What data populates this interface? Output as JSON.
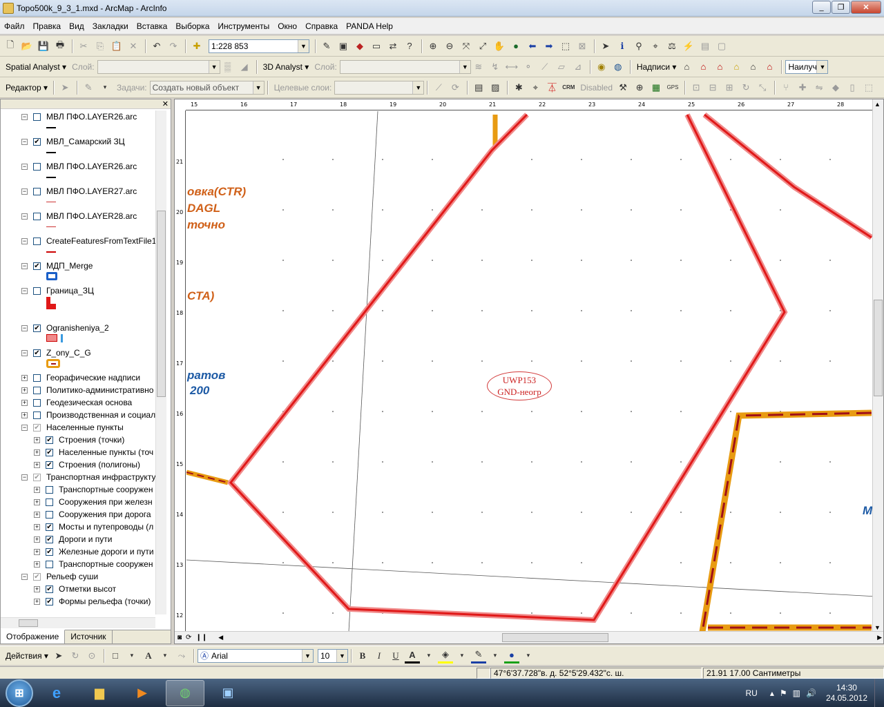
{
  "window": {
    "title": "Topo500k_9_3_1.mxd - ArcMap - ArcInfo"
  },
  "menu": [
    "Файл",
    "Правка",
    "Вид",
    "Закладки",
    "Вставка",
    "Выборка",
    "Инструменты",
    "Окно",
    "Справка",
    "PANDA Help"
  ],
  "standard": {
    "scale": "1:228 853"
  },
  "spatial": {
    "spatial_analyst": "Spatial Analyst",
    "layer_label": "Слой:",
    "analyst_3d": "3D Analyst",
    "layer_label2": "Слой:",
    "labels_menu": "Надписи",
    "best_combo": "Наилуч"
  },
  "editor": {
    "editor_menu": "Редактор",
    "task_label": "Задачи:",
    "task_value": "Создать новый объект",
    "target_label": "Целевые слои:",
    "disabled_label": "Disabled"
  },
  "toc": {
    "layers": [
      {
        "label": "МВЛ ПФО.LAYER26.arc",
        "checked": false,
        "level": 0,
        "exp": "−"
      },
      {
        "label": "МВЛ_Самарский ЗЦ",
        "checked": true,
        "level": 0,
        "exp": "−"
      },
      {
        "label": "МВЛ ПФО.LAYER26.arc",
        "checked": false,
        "level": 0,
        "exp": "−"
      },
      {
        "label": "МВЛ ПФО.LAYER27.arc",
        "checked": false,
        "level": 0,
        "exp": "−"
      },
      {
        "label": "МВЛ ПФО.LAYER28.arc",
        "checked": false,
        "level": 0,
        "exp": "−"
      },
      {
        "label": "CreateFeaturesFromTextFile1",
        "checked": false,
        "level": 0,
        "exp": "−"
      },
      {
        "label": "МДП_Merge",
        "checked": true,
        "level": 0,
        "exp": "−"
      },
      {
        "label": "Граница_ЗЦ",
        "checked": false,
        "level": 0,
        "exp": "−"
      },
      {
        "label": "Ogranisheniya_2",
        "checked": true,
        "level": 0,
        "exp": "−"
      },
      {
        "label": "Z_ony_C_G",
        "checked": true,
        "level": 0,
        "exp": "−"
      },
      {
        "label": "Георафические надписи",
        "checked": false,
        "level": 0,
        "exp": "+"
      },
      {
        "label": "Политико-административно",
        "checked": false,
        "level": 0,
        "exp": "+"
      },
      {
        "label": "Геодезическая основа",
        "checked": false,
        "level": 0,
        "exp": "+"
      },
      {
        "label": "Производственная и социал",
        "checked": false,
        "level": 0,
        "exp": "+"
      },
      {
        "label": "Населенные пункты",
        "checked": true,
        "level": 0,
        "exp": "−",
        "gray": true
      },
      {
        "label": "Строения (точки)",
        "checked": true,
        "level": 1,
        "exp": "+"
      },
      {
        "label": "Населенные пункты (точ",
        "checked": true,
        "level": 1,
        "exp": "+"
      },
      {
        "label": "Строения (полигоны)",
        "checked": true,
        "level": 1,
        "exp": "+"
      },
      {
        "label": "Транспортная инфраструкту",
        "checked": true,
        "level": 0,
        "exp": "−",
        "gray": true
      },
      {
        "label": "Транспортные сооружен",
        "checked": false,
        "level": 1,
        "exp": "+"
      },
      {
        "label": "Сооружения при железн",
        "checked": false,
        "level": 1,
        "exp": "+"
      },
      {
        "label": "Сооружения при дорога",
        "checked": false,
        "level": 1,
        "exp": "+"
      },
      {
        "label": "Мосты и путепроводы (л",
        "checked": true,
        "level": 1,
        "exp": "+"
      },
      {
        "label": "Дороги и пути",
        "checked": true,
        "level": 1,
        "exp": "+"
      },
      {
        "label": "Железные дороги и пути",
        "checked": true,
        "level": 1,
        "exp": "+"
      },
      {
        "label": "Транспортные сооружен",
        "checked": false,
        "level": 1,
        "exp": "+"
      },
      {
        "label": "Рельеф суши",
        "checked": true,
        "level": 0,
        "exp": "−",
        "gray": true
      },
      {
        "label": "Отметки высот",
        "checked": true,
        "level": 1,
        "exp": "+"
      },
      {
        "label": "Формы рельефа (точки)",
        "checked": true,
        "level": 1,
        "exp": "+"
      }
    ],
    "tabs": [
      "Отображение",
      "Источник"
    ]
  },
  "map": {
    "labels": {
      "a1": "овка(CTR)",
      "a2": "DAGL",
      "a3": "точно",
      "a4": "CTA)",
      "b1": "ратов",
      "b2": "200",
      "c1": "М"
    },
    "uwp": {
      "line1": "UWP153",
      "line2": "GND-неогр"
    },
    "ruler_top": [
      "15",
      "16",
      "17",
      "18",
      "19",
      "20",
      "21",
      "22",
      "23",
      "24",
      "25",
      "26",
      "27",
      "28"
    ],
    "ruler_left": [
      "21",
      "20",
      "19",
      "18",
      "17",
      "16",
      "15",
      "14",
      "13",
      "12"
    ]
  },
  "draw": {
    "actions": "Действия",
    "font": "Arial",
    "size": "10",
    "bold": "B",
    "italic": "I",
    "underline": "U",
    "text_tool": "A",
    "font_color": "A"
  },
  "status": {
    "coords": "47°6'37.728\"в. д.  52°5'29.432\"с. ш.",
    "page": "21.91  17.00 Сантиметры"
  },
  "taskbar": {
    "lang": "RU",
    "time": "14:30",
    "date": "24.05.2012"
  },
  "colors": {
    "red": "#e01818",
    "pink": "#f08a8a",
    "orange": "#e89b12",
    "darkred": "#a01018"
  }
}
